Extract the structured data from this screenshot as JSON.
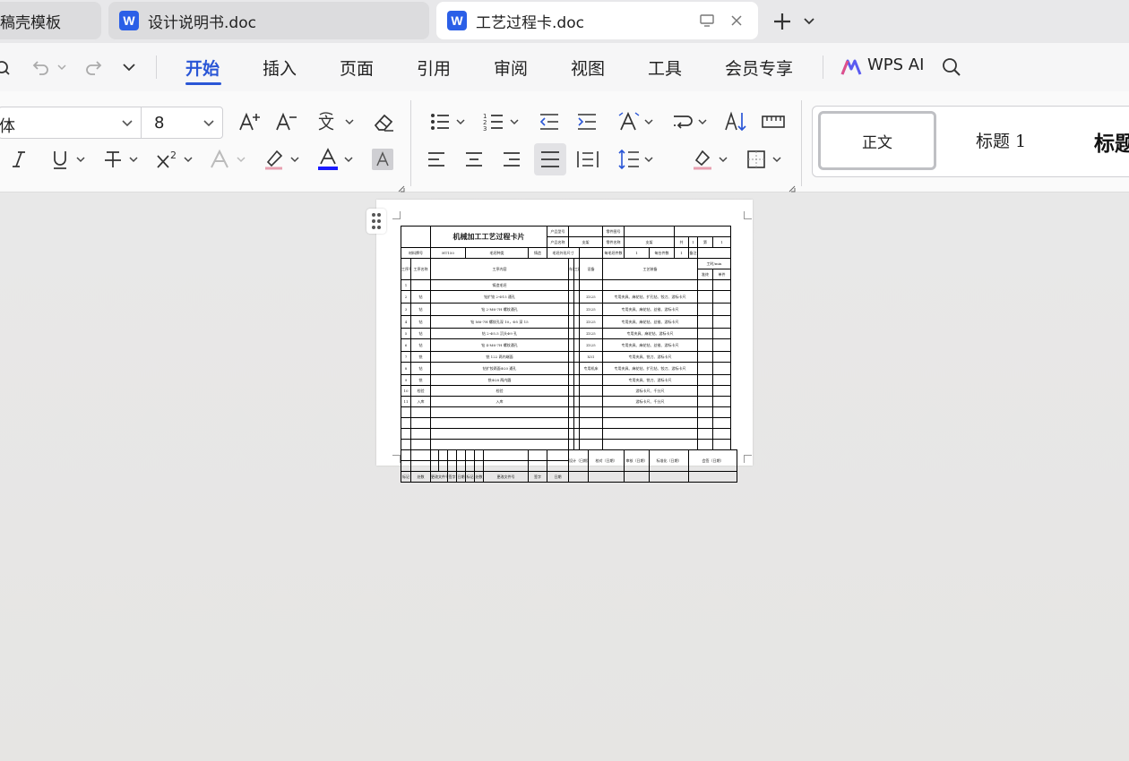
{
  "tabs": [
    {
      "label": "稿壳模板",
      "active": false
    },
    {
      "label": "设计说明书.doc",
      "active": false
    },
    {
      "label": "工艺过程卡.doc",
      "active": true
    }
  ],
  "menu": {
    "items": [
      "开始",
      "插入",
      "页面",
      "引用",
      "审阅",
      "视图",
      "工具",
      "会员专享"
    ],
    "active": "开始",
    "wps_ai": "WPS AI"
  },
  "ribbon": {
    "font_name": "体",
    "font_size": "8",
    "font_color": "#1a1aff",
    "accent": "#2a56d6",
    "styles": {
      "normal": "正文",
      "heading1": "标题 1",
      "heading2": "标题"
    }
  },
  "card": {
    "title": "机械加工工艺过程卡片",
    "h_product_model": "产品型号",
    "h_part_no": "零件图号",
    "h_product_name": "产品名称",
    "v_product_name": "支架",
    "h_part_name": "零件名称",
    "v_part_name": "支架",
    "v_total": "共",
    "v_page1": "1",
    "v_page2": "页",
    "v_sheet": "第",
    "v_sheet2": "1",
    "v_sheet3": "页",
    "h_material": "材料牌号",
    "v_material": "HT150",
    "h_blank_type": "毛坯种类",
    "v_blank_type": "铸造",
    "h_blank_size": "毛坯外形尺寸",
    "h_pieces_blank": "每毛坯件数",
    "v_pieces": "1",
    "h_pieces_unit": "每台件数",
    "v_unit": "1",
    "h_notes": "备注",
    "h_seq": "工序号",
    "h_name": "工序名称",
    "h_content": "工序内容",
    "h_workshop": "车间",
    "h_section": "工段",
    "h_equipment": "设备",
    "h_tooling": "工艺装备",
    "h_time": "工时/min",
    "h_time_a": "准终",
    "h_time_b": "单件",
    "rows": [
      {
        "no": "1",
        "name": "",
        "content": "铸造毛坯",
        "equip": "",
        "tool": ""
      },
      {
        "no": "2",
        "name": "钻",
        "content": "钻扩铰 2-Φ15 通孔",
        "equip": "Z525",
        "tool": "专用夹具、麻花钻、扩孔钻、铰刀、游标卡尺"
      },
      {
        "no": "3",
        "name": "钻",
        "content": "钻 2-M6-7H 螺纹通孔",
        "equip": "Z525",
        "tool": "专用夹具、麻花钻、丝锥、游标卡尺"
      },
      {
        "no": "4",
        "name": "钻",
        "content": "钻 M6-7H 螺纹孔深 10，Φ5 深 15",
        "equip": "Z525",
        "tool": "专用夹具、麻花钻、丝锥、游标卡尺"
      },
      {
        "no": "5",
        "name": "钻",
        "content": "钻 2-Φ5.5 沉头Φ9 孔",
        "equip": "Z525",
        "tool": "专用夹具、麻花钻、游标卡尺"
      },
      {
        "no": "6",
        "name": "钻",
        "content": "钻 4-M6-7H 螺纹通孔",
        "equip": "Z525",
        "tool": "专用夹具、麻花钻、丝锥、游标卡尺"
      },
      {
        "no": "7",
        "name": "铣",
        "content": "铣 122 两内端面",
        "equip": "X51",
        "tool": "专用夹具、铣刀、游标卡尺"
      },
      {
        "no": "8",
        "name": "钻",
        "content": "钻扩铰两面Φ20 通孔",
        "equip": "专用机床",
        "tool": "专用夹具、麻花钻、扩孔钻、铰刀、游标卡尺"
      },
      {
        "no": "9",
        "name": "铣",
        "content": "铣Φ28 两内圆",
        "equip": "",
        "tool": "专用夹具、铣刀、游标卡尺"
      },
      {
        "no": "10",
        "name": "检验",
        "content": "检验",
        "equip": "",
        "tool": "游标卡尺、千分尺"
      },
      {
        "no": "11",
        "name": "入库",
        "content": "入库",
        "equip": "",
        "tool": "游标卡尺、千分尺"
      }
    ],
    "sign": {
      "design": "设计（日期）",
      "check": "校对（日期）",
      "review": "审核（日期）",
      "standard": "标准化（日期）",
      "sign": "会签（日期）",
      "mark": "标记",
      "places": "处数",
      "change_doc": "更改文件号",
      "signature": "签字",
      "date": "日期"
    }
  }
}
